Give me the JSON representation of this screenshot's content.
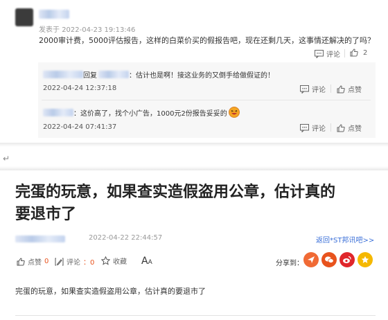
{
  "comment": {
    "posted_label": "发表于",
    "posted_time": "2022-04-23 19:13:46",
    "text": "2000审计费，5000评估报告，这样的白菜价买的假报告吧，现在还剩几天，这事情还解决的了吗？",
    "comment_label": "评论",
    "like_count": "2",
    "replies": [
      {
        "reply_word": "回复",
        "text": "：估计也是啊！接这业务的又倒手给做假证的！",
        "time": "2022-04-24 12:37:18",
        "comment_label": "评论",
        "like_label": "点赞"
      },
      {
        "text": "：这价高了，找个小广告，1000元2份报告妥妥的",
        "time": "2022-04-24 07:41:37",
        "comment_label": "评论",
        "like_label": "点赞"
      }
    ]
  },
  "separator_mark": "↵",
  "article": {
    "title_line1": "完蛋的玩意，如果查实造假盗用公章，估计真的",
    "title_line2": "要退市了",
    "time": "2022-04-22 22:44:57",
    "back_link": "返回*ST邦讯吧>>",
    "actions": {
      "like_label": "点赞",
      "like_count": "0",
      "comment_label": "评论",
      "comment_count": "：0",
      "favorite_label": "收藏",
      "font_label": "A",
      "font_label_small": "A"
    },
    "share_label": "分享到：",
    "share_icons": [
      "zhuanfa-icon",
      "wechat-icon",
      "weibo-icon",
      "qzone-icon"
    ],
    "share_colors": [
      "#f06a35",
      "#e8531d",
      "#e0262b",
      "#f5b800"
    ],
    "body": "完蛋的玩意，如果查实造假盗用公章，估计真的要退市了"
  }
}
